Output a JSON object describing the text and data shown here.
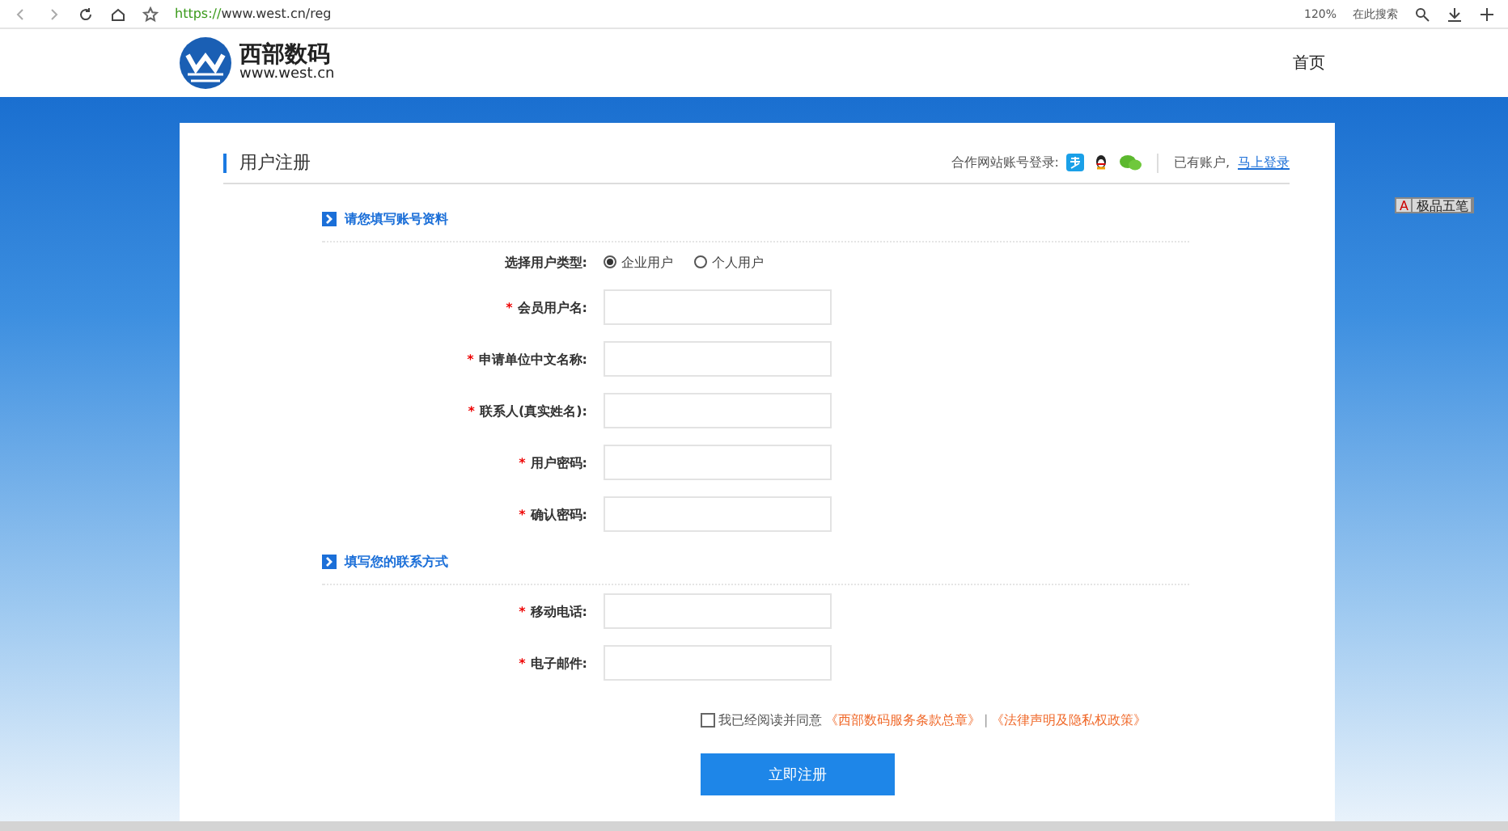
{
  "browser": {
    "url_scheme": "https://",
    "url_rest": "www.west.cn/reg",
    "zoom": "120%",
    "search_label": "在此搜索"
  },
  "header": {
    "logo_name": "西部数码",
    "logo_domain": "www.west.cn",
    "nav": [
      {
        "label": "首页"
      }
    ]
  },
  "card": {
    "title": "用户注册",
    "partner_label": "合作网站账号登录:",
    "account_text": "已有账户,",
    "login_link": "马上登录",
    "sections": [
      {
        "title": "请您填写账号资料",
        "rows": [
          {
            "kind": "radio",
            "label": "选择用户类型:",
            "options": [
              {
                "label": "企业用户",
                "selected": true
              },
              {
                "label": "个人用户",
                "selected": false
              }
            ]
          },
          {
            "kind": "input",
            "required_mark": "*",
            "label": "会员用户名:"
          },
          {
            "kind": "input",
            "required_mark": "*",
            "label": "申请单位中文名称:"
          },
          {
            "kind": "input",
            "required_mark": "*",
            "label": "联系人(真实姓名):"
          },
          {
            "kind": "input",
            "required_mark": "*",
            "label": "用户密码:"
          },
          {
            "kind": "input",
            "required_mark": "*",
            "label": "确认密码:"
          }
        ]
      },
      {
        "title": "填写您的联系方式",
        "rows": [
          {
            "kind": "input",
            "required_mark": "*",
            "label": "移动电话:"
          },
          {
            "kind": "input",
            "required_mark": "*",
            "label": "电子邮件:"
          }
        ]
      }
    ],
    "agreement": {
      "checked": false,
      "text": "我已经阅读并同意",
      "link1": "《西部数码服务条款总章》",
      "separator": "|",
      "link2": "《法律声明及隐私权政策》"
    },
    "submit": "立即注册"
  },
  "ime": {
    "mode": "A",
    "name": "极品五笔"
  }
}
